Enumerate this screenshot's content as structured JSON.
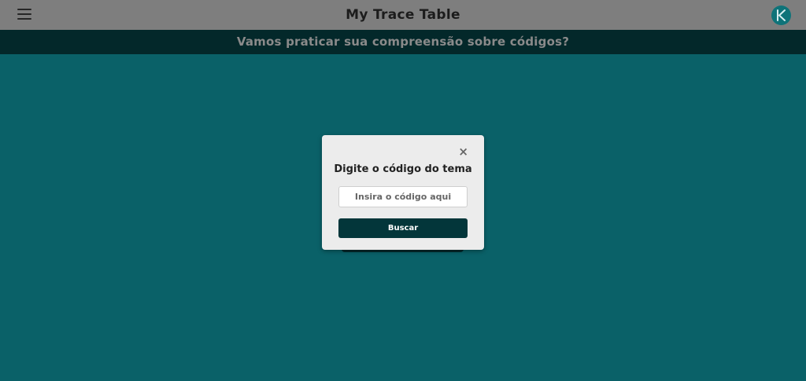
{
  "header": {
    "title": "My Trace Table",
    "menu_icon": "hamburger-menu-icon",
    "logo_icon": "play-logo-icon"
  },
  "subheader": {
    "text": "Vamos praticar sua compreensão sobre códigos?"
  },
  "modal": {
    "close_symbol": "×",
    "title": "Digite o código do tema",
    "input_placeholder": "Insira o código aqui",
    "input_value": "",
    "submit_label": "Buscar"
  },
  "colors": {
    "background": "#0a6168",
    "header": "#7e7e7e",
    "subheader": "#03282a",
    "modal": "#ececec",
    "button": "#03363a"
  }
}
